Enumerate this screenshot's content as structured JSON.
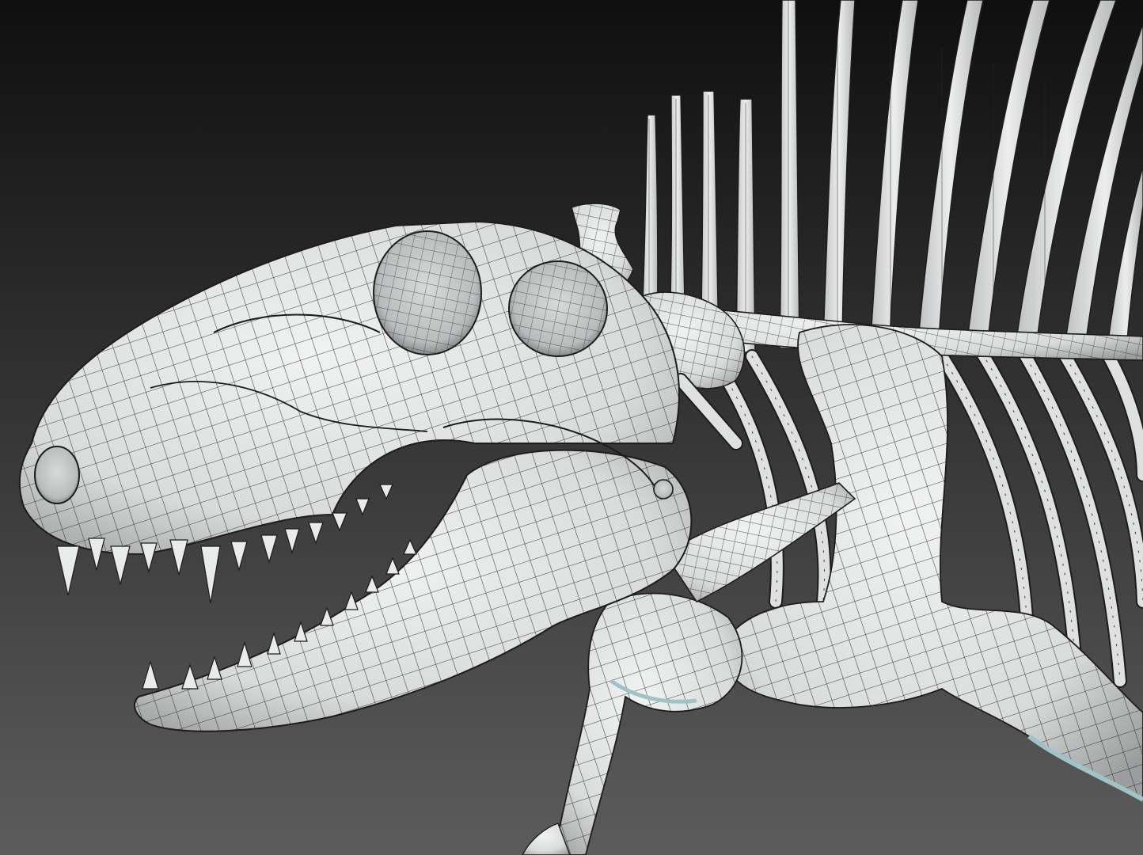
{
  "scene": {
    "subject": "skeleton-wireframe-render",
    "colors": {
      "background_top": "#0f0f0f",
      "background_bottom": "#5c5c5c",
      "bone": "#e6e7e7",
      "bone_shade": "#9a9c9d",
      "wire": "#1c1c1c",
      "cartilage": "#9fc3c7"
    }
  }
}
